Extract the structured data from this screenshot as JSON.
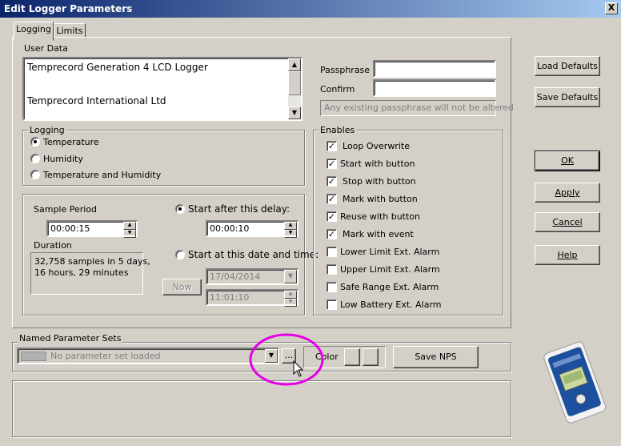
{
  "window": {
    "title": "Edit Logger Parameters",
    "close_label": "X"
  },
  "tabs": [
    {
      "label": "Logging",
      "active": true
    },
    {
      "label": "Limits",
      "active": false
    }
  ],
  "user_data": {
    "label": "User Data",
    "lines": [
      "Temprecord Generation 4 LCD Logger",
      "Temprecord International Ltd"
    ]
  },
  "passphrase": {
    "passphrase_label": "Passphrase",
    "confirm_label": "Confirm",
    "passphrase_value": "",
    "confirm_value": "",
    "note": "Any existing passphrase will not be altered"
  },
  "logging": {
    "label": "Logging",
    "options": [
      {
        "label": "Temperature",
        "selected": true
      },
      {
        "label": "Humidity",
        "selected": false
      },
      {
        "label": "Temperature and Humidity",
        "selected": false
      }
    ]
  },
  "sample": {
    "sample_period_label": "Sample Period",
    "sample_period_value": "00:00:15",
    "duration_label": "Duration",
    "duration_lines": [
      "32,758 samples in 5 days,",
      "16 hours, 29 minutes"
    ],
    "start_delay_label": "Start after this delay:",
    "start_delay_value": "00:00:10",
    "start_date_label": "Start at this date and time:",
    "now_label": "Now",
    "date_value": "17/04/2014",
    "time_value": "11:01:10"
  },
  "enables": {
    "label": "Enables",
    "items": [
      {
        "label": "Loop Overwrite",
        "checked": true
      },
      {
        "label": "Start with button",
        "checked": true
      },
      {
        "label": "Stop with button",
        "checked": true
      },
      {
        "label": "Mark with button",
        "checked": true
      },
      {
        "label": "Reuse with button",
        "checked": true
      },
      {
        "label": "Mark with event",
        "checked": true
      },
      {
        "label": "Lower Limit Ext. Alarm",
        "checked": false
      },
      {
        "label": "Upper Limit Ext. Alarm",
        "checked": false
      },
      {
        "label": "Safe Range Ext. Alarm",
        "checked": false
      },
      {
        "label": "Low Battery Ext. Alarm",
        "checked": false
      }
    ]
  },
  "nps": {
    "label": "Named Parameter Sets",
    "selected": "No parameter set loaded",
    "ellipsis_label": "...",
    "color_label": "Color",
    "save_label": "Save NPS"
  },
  "buttons": {
    "load_defaults": "Load Defaults",
    "save_defaults": "Save Defaults",
    "ok": "OK",
    "apply": "Apply",
    "cancel": "Cancel",
    "help": "Help"
  },
  "colors": {
    "highlight": "#e600e6",
    "titlebar_start": "#0a246a",
    "titlebar_end": "#a6caf0"
  }
}
